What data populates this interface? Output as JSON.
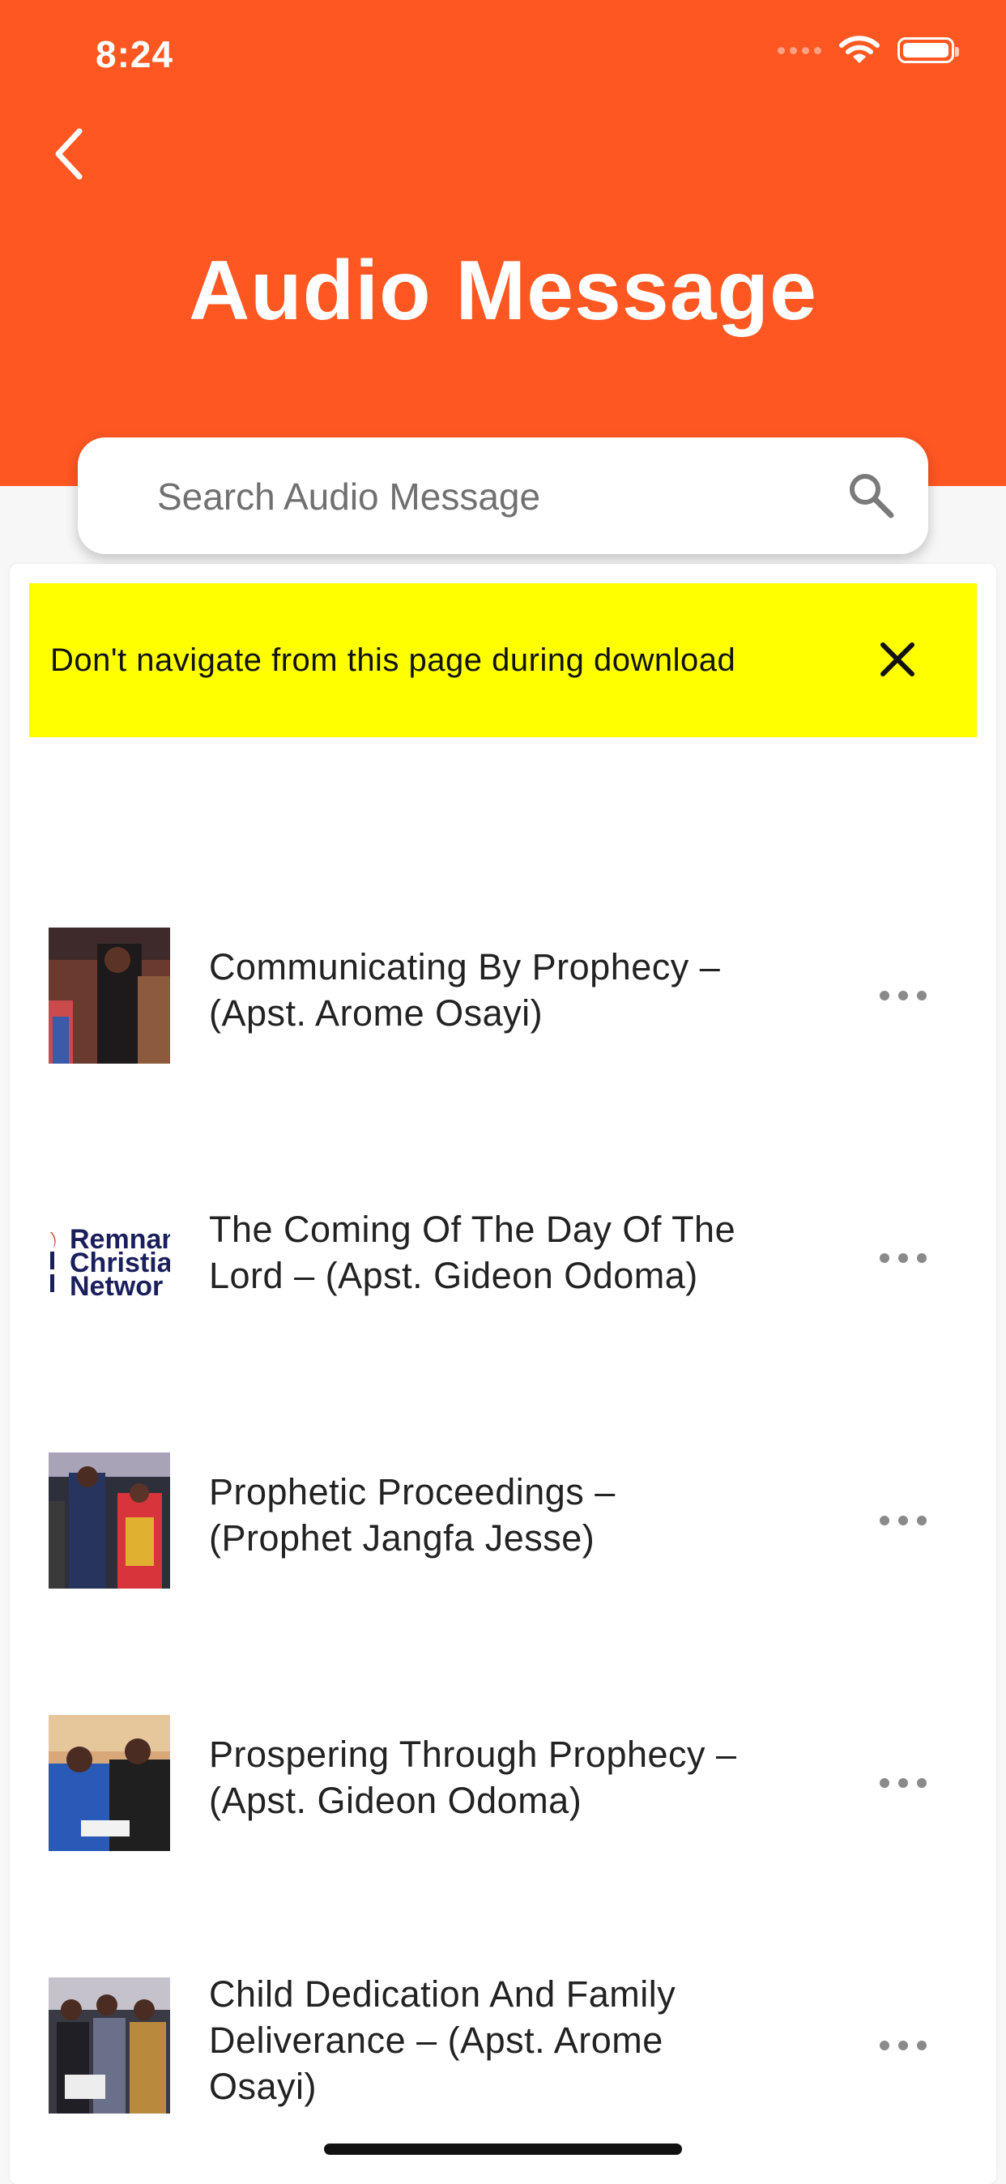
{
  "status_bar": {
    "time": "8:24"
  },
  "header": {
    "title": "Audio Message"
  },
  "search": {
    "placeholder": "Search Audio Message"
  },
  "banner": {
    "text": "Don't navigate from this page during download"
  },
  "thumb_logo_lines": [
    "Remnan",
    "Christia",
    "Networ"
  ],
  "audio_list": [
    {
      "line1": "Communicating By Prophecy –",
      "line2": "(Apst. Arome Osayi)",
      "line3": ""
    },
    {
      "line1": "The Coming Of The Day Of The",
      "line2": "Lord – (Apst. Gideon Odoma)",
      "line3": ""
    },
    {
      "line1": "Prophetic Proceedings –",
      "line2": "(Prophet Jangfa Jesse)",
      "line3": ""
    },
    {
      "line1": "Prospering Through Prophecy –",
      "line2": "(Apst. Gideon Odoma)",
      "line3": ""
    },
    {
      "line1": "Child Dedication And Family",
      "line2": "Deliverance – (Apst. Arome",
      "line3": "Osayi)"
    }
  ],
  "colors": {
    "header": "#ff5722",
    "banner": "#ffff00"
  }
}
